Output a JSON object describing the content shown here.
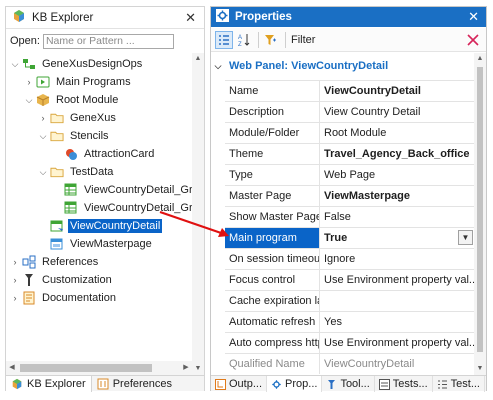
{
  "kb_explorer": {
    "title": "KB Explorer",
    "open_label": "Open:",
    "open_placeholder": "Name or Pattern ...",
    "tree": [
      {
        "label": "GeneXusDesignOps",
        "icon": "kb-root-icon"
      },
      {
        "label": "Main Programs",
        "icon": "main-programs-icon"
      },
      {
        "label": "Root Module",
        "icon": "module-icon"
      },
      {
        "label": "GeneXus",
        "icon": "folder-icon"
      },
      {
        "label": "Stencils",
        "icon": "folder-icon"
      },
      {
        "label": "AttractionCard",
        "icon": "stencil-icon"
      },
      {
        "label": "TestData",
        "icon": "folder-icon"
      },
      {
        "label": "ViewCountryDetail_Grid_A",
        "icon": "data-provider-icon"
      },
      {
        "label": "ViewCountryDetail_Grid_A",
        "icon": "data-provider-icon"
      },
      {
        "label": "ViewCountryDetail",
        "icon": "web-panel-icon",
        "selected": true
      },
      {
        "label": "ViewMasterpage",
        "icon": "master-page-icon"
      },
      {
        "label": "References",
        "icon": "references-icon"
      },
      {
        "label": "Customization",
        "icon": "customization-icon"
      },
      {
        "label": "Documentation",
        "icon": "documentation-icon"
      }
    ],
    "tabs": [
      {
        "label": "KB Explorer",
        "icon": "kb-explorer-icon",
        "active": true
      },
      {
        "label": "Preferences",
        "icon": "preferences-icon",
        "active": false
      }
    ]
  },
  "properties": {
    "title": "Properties",
    "toolbar": {
      "filter_label": "Filter"
    },
    "category": "Web Panel: ViewCountryDetail",
    "rows": [
      {
        "name": "Name",
        "value": "ViewCountryDetail",
        "bold": true
      },
      {
        "name": "Description",
        "value": "View Country Detail"
      },
      {
        "name": "Module/Folder",
        "value": "Root Module"
      },
      {
        "name": "Theme",
        "value": "Travel_Agency_Back_office",
        "bold": true
      },
      {
        "name": "Type",
        "value": "Web Page"
      },
      {
        "name": "Master Page",
        "value": "ViewMasterpage",
        "bold": true
      },
      {
        "name": "Show Master Page v",
        "value": "False"
      },
      {
        "name": "Main program",
        "value": "True",
        "bold": true,
        "selected": true,
        "dropdown": true
      },
      {
        "name": "On session timeout",
        "value": "Ignore"
      },
      {
        "name": "Focus control",
        "value": "Use Environment property val..."
      },
      {
        "name": "Cache expiration lap",
        "value": ""
      },
      {
        "name": "Automatic refresh",
        "value": "Yes"
      },
      {
        "name": "Auto compress http",
        "value": "Use Environment property val..."
      },
      {
        "name": "Qualified Name",
        "value": "ViewCountryDetail",
        "disabled": true
      }
    ],
    "tabs": [
      {
        "label": "Outp...",
        "icon": "output-icon"
      },
      {
        "label": "Prop...",
        "icon": "properties-icon",
        "active": true
      },
      {
        "label": "Tool...",
        "icon": "toolbox-icon"
      },
      {
        "label": "Tests...",
        "icon": "tests-icon"
      },
      {
        "label": "Test...",
        "icon": "test-list-icon"
      }
    ]
  },
  "colors": {
    "accent": "#1a6fc4",
    "selection": "#0a64c8",
    "annotation_arrow": "#e01010"
  }
}
